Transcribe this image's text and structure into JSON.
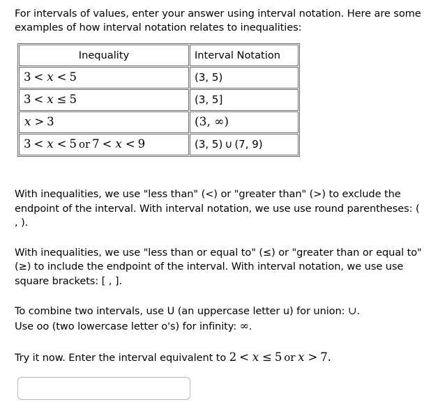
{
  "intro": {
    "text": "For intervals of values, enter your answer using interval notation. Here are some examples of how interval notation relates to inequalities:"
  },
  "table": {
    "headers": {
      "inequality": "Inequality",
      "interval_notation": "Interval Notation"
    },
    "rows": [
      {
        "inequality_parts": {
          "a": "3",
          "op1": "<",
          "var": "x",
          "op2": "<",
          "b": "5"
        },
        "inequality_text": "3 < x < 5",
        "interval": "(3, 5)"
      },
      {
        "inequality_parts": {
          "a": "3",
          "op1": "<",
          "var": "x",
          "op2": "≤",
          "b": "5"
        },
        "inequality_text": "3 < x ≤ 5",
        "interval": "(3, 5]"
      },
      {
        "inequality_parts": {
          "a": "",
          "op1": "",
          "var": "x",
          "op2": ">",
          "b": "3"
        },
        "inequality_text": "x > 3",
        "interval": "(3, ∞)"
      },
      {
        "inequality_parts": {
          "a": "3",
          "op1": "<",
          "var": "x",
          "op2": "<",
          "b": "5",
          "word": "or",
          "c": "7",
          "op3": "<",
          "var2": "x",
          "op4": "<",
          "d": "9"
        },
        "inequality_text": "3 < x < 5 or 7 < x < 9",
        "interval_left": "(3, 5)",
        "union_symbol": "∪",
        "interval_right": "(7, 9)"
      }
    ]
  },
  "paragraphs": {
    "exclude": "With inequalities, we use \"less than\" (<) or \"greater than\" (>) to exclude the endpoint of the interval. With interval notation, we use use round parentheses: ( , ).",
    "include": "With inequalities, we use \"less than or equal to\" (≤) or \"greater than or equal to\" (≥) to include the endpoint of the interval. With interval notation, we use use square brackets: [ , ].",
    "union_line_prefix": "To combine two intervals, use U (an uppercase letter u) for union:",
    "union_symbol": "∪",
    "union_line_suffix": ".",
    "infinity_line_prefix": "Use oo (two lowercase letter o's) for infinity:",
    "infinity_symbol": "∞",
    "infinity_line_suffix": "."
  },
  "prompt": {
    "lead": "Try it now. Enter the interval equivalent to",
    "math": {
      "a": "2",
      "op1": "<",
      "var": "x",
      "op2": "≤",
      "b": "5",
      "word": "or",
      "var2": "x",
      "op3": ">",
      "c": "7"
    },
    "math_text": "2 < x ≤ 5 or x > 7.",
    "period": "."
  },
  "answer_input": {
    "value": "",
    "placeholder": ""
  }
}
